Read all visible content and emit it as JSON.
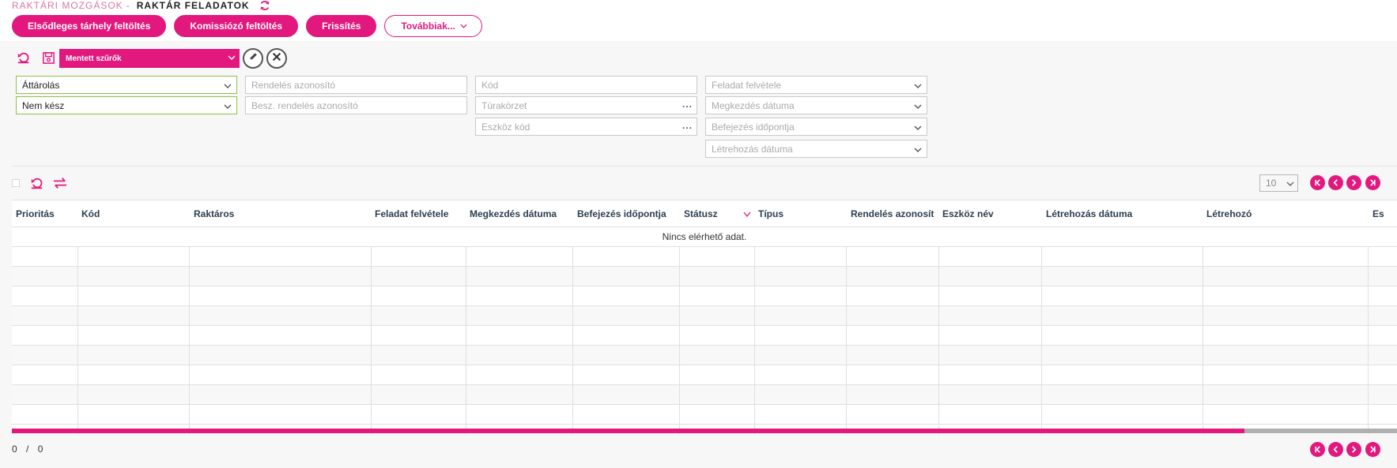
{
  "breadcrumb": {
    "parent": "Raktári mozgások",
    "separator": "-",
    "current": "Raktár feladatok"
  },
  "top_actions": {
    "primary_storage_fill": "Elsődleges tárhely feltöltés",
    "picker_fill": "Komissiózó feltöltés",
    "refresh": "Frissítés",
    "more": "Továbbiak..."
  },
  "saved_filters": {
    "label": "Mentett szűrők"
  },
  "filters": {
    "type": {
      "value": "Áttárolás"
    },
    "status": {
      "value": "Nem kész"
    },
    "order_id": {
      "placeholder": "Rendelés azonosító"
    },
    "purchase_order_id": {
      "placeholder": "Besz. rendelés azonosító"
    },
    "code": {
      "placeholder": "Kód"
    },
    "tour_area": {
      "placeholder": "Túrakörzet"
    },
    "device_code": {
      "placeholder": "Eszköz kód"
    },
    "task_received": {
      "placeholder": "Feladat felvétele"
    },
    "start_date": {
      "placeholder": "Megkezdés dátuma"
    },
    "end_time": {
      "placeholder": "Befejezés időpontja"
    },
    "created_date": {
      "placeholder": "Létrehozás dátuma"
    }
  },
  "grid": {
    "page_size": "10",
    "columns": [
      "Prioritás",
      "Kód",
      "Raktáros",
      "Feladat felvétele",
      "Megkezdés dátuma",
      "Befejezés időpontja",
      "Státusz",
      "Típus",
      "Rendelés azonosít",
      "Eszköz név",
      "Létrehozás dátuma",
      "Létrehozó",
      "Es"
    ],
    "empty_message": "Nincs elérhető adat.",
    "scroll_position": 0.89
  },
  "pager": {
    "current": "0",
    "separator": "/",
    "total": "0"
  },
  "colors": {
    "accent": "#e2187e",
    "valid_border": "#8bc34a"
  },
  "icons": [
    "refresh-icon",
    "undo-icon",
    "save-icon",
    "edit-icon",
    "clear-icon",
    "swap-icon",
    "first-page-icon",
    "prev-page-icon",
    "next-page-icon",
    "last-page-icon"
  ]
}
